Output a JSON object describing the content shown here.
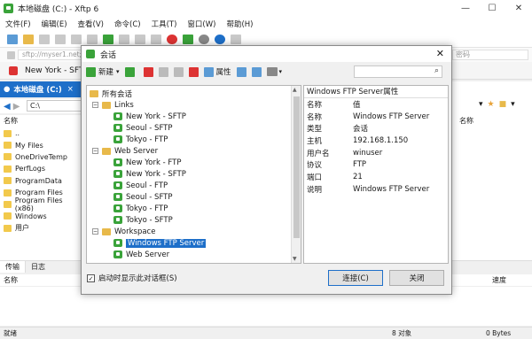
{
  "window": {
    "title": "本地磁盘 (C:) - Xftp 6",
    "min": "—",
    "max": "☐",
    "close": "✕"
  },
  "menu": [
    "文件(F)",
    "编辑(E)",
    "查看(V)",
    "命令(C)",
    "工具(T)",
    "窗口(W)",
    "帮助(H)"
  ],
  "address": {
    "value": "sftp://myser1.net;a",
    "password_placeholder": "密码"
  },
  "session_tab": {
    "label": "New York - SFTP"
  },
  "local_tab": {
    "label": "本地磁盘 (C:)",
    "close": "×"
  },
  "local_path": "C:\\",
  "local_header": "名称",
  "local_files": [
    "..",
    "My Files",
    "OneDriveTemp",
    "PerfLogs",
    "ProgramData",
    "Program Files",
    "Program Files (x86)",
    "Windows",
    "用户"
  ],
  "right_header": "名称",
  "bottom": {
    "tabs": [
      "传输",
      "日志"
    ],
    "col_name": "名称",
    "col_speed": "速度"
  },
  "status": {
    "left": "就绪",
    "count": "8 对象",
    "size": "0 Bytes"
  },
  "dialog": {
    "title": "会话",
    "close": "✕",
    "toolbar": {
      "new": "新建",
      "properties": "属性"
    },
    "tree": {
      "root": "所有会话",
      "groups": [
        {
          "name": "Links",
          "items": [
            "New York - SFTP",
            "Seoul - SFTP",
            "Tokyo - FTP"
          ]
        },
        {
          "name": "Web Server",
          "items": [
            "New York - FTP",
            "New York - SFTP",
            "Seoul - FTP",
            "Seoul - SFTP",
            "Tokyo - FTP",
            "Tokyo - SFTP"
          ]
        },
        {
          "name": "Workspace",
          "items": [
            "Windows FTP Server",
            "Web Server"
          ]
        }
      ],
      "selected": "Windows FTP Server"
    },
    "props": {
      "title": "Windows FTP Server属性",
      "rows": [
        {
          "k": "名称",
          "v": "值"
        },
        {
          "k": "名称",
          "v": "Windows FTP Server"
        },
        {
          "k": "类型",
          "v": "会话"
        },
        {
          "k": "主机",
          "v": "192.168.1.150"
        },
        {
          "k": "用户名",
          "v": "winuser"
        },
        {
          "k": "协议",
          "v": "FTP"
        },
        {
          "k": "端口",
          "v": "21"
        },
        {
          "k": "说明",
          "v": "Windows FTP Server"
        }
      ]
    },
    "startup_checkbox": "启动时显示此对话框(S)",
    "connect": "连接(C)",
    "close_btn": "关闭"
  },
  "colors": {
    "accent": "#1e6fc9",
    "session_green": "#3aa33a",
    "folder": "#e8b94a"
  },
  "icons": [
    "new-session-icon",
    "cut-icon",
    "copy-icon",
    "paste-icon",
    "delete-icon",
    "properties-icon",
    "search-icon",
    "folder-icon",
    "session-icon"
  ]
}
